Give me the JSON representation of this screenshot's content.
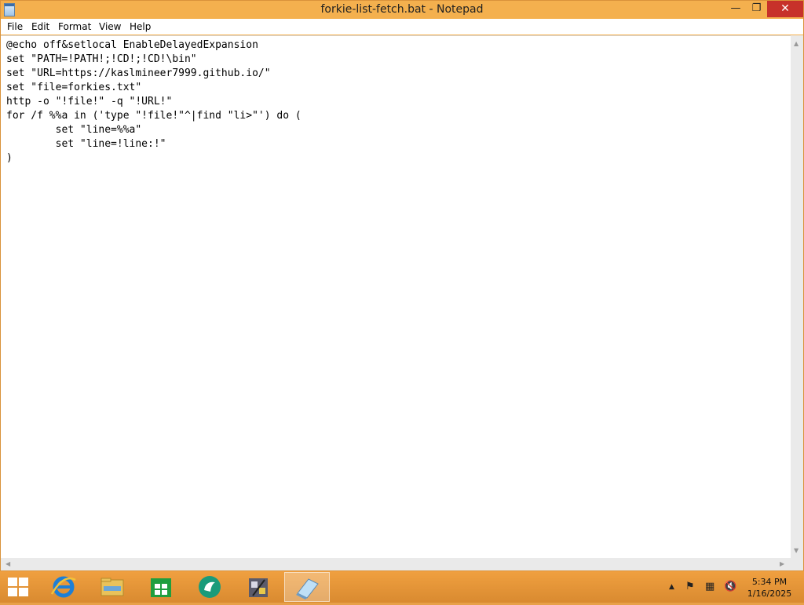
{
  "window": {
    "title": "forkie-list-fetch.bat - Notepad",
    "controls": {
      "minimize": "—",
      "maximize": "❐",
      "close": "✕"
    }
  },
  "menu": {
    "file": "File",
    "edit": "Edit",
    "format": "Format",
    "view": "View",
    "help": "Help"
  },
  "editor": {
    "lines": [
      "@echo off&setlocal EnableDelayedExpansion",
      "set \"PATH=!PATH!;!CD!;!CD!\\bin\"",
      "set \"URL=https://kaslmineer7999.github.io/\"",
      "set \"file=forkies.txt\"",
      "http -o \"!file!\" -q \"!URL!\"",
      "for /f %%a in ('type \"!file!\"^|find \"li>\"') do (",
      "        set \"line=%%a\"",
      "        set \"line=!line:!\"",
      ")"
    ]
  },
  "taskbar": {
    "pinned": [
      {
        "name": "internet-explorer-icon"
      },
      {
        "name": "file-explorer-icon"
      },
      {
        "name": "windows-store-icon"
      },
      {
        "name": "green-app-icon"
      },
      {
        "name": "game-app-icon"
      },
      {
        "name": "notepad-icon",
        "active": true
      }
    ],
    "tray": {
      "show_hidden": "▲",
      "flag": "⚑",
      "network": "▦",
      "volume": "🔇"
    },
    "clock": {
      "time": "5:34 PM",
      "date": "1/16/2025"
    }
  },
  "colors": {
    "accent": "#f4b04e",
    "taskbar": "#e39638",
    "close": "#c7312a"
  }
}
